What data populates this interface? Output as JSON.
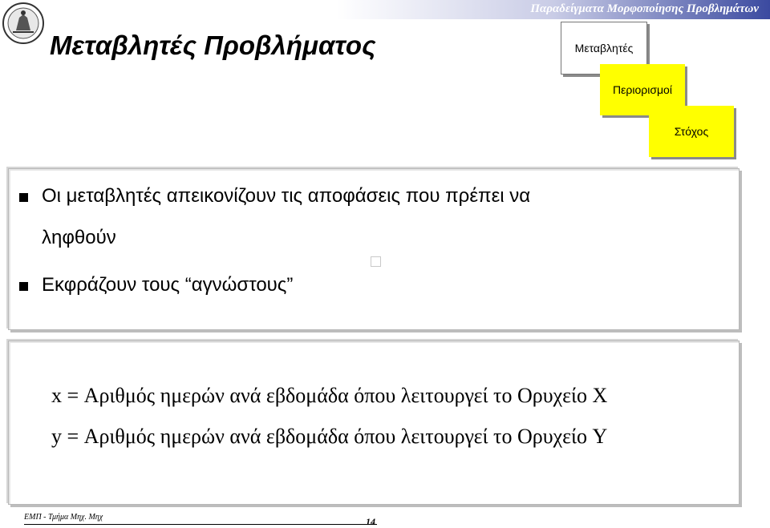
{
  "header": {
    "banner_text": "Παραδείγματα  Μορφοποίησης Προβλημάτων",
    "title": "Μεταβλητές Προβλήματος",
    "logo_icon": "university-seal-icon"
  },
  "tags": {
    "variables": "Μεταβλητές",
    "constraints": "Περιορισμοί",
    "goal": "Στόχος",
    "active_color": "#ffff00"
  },
  "bullets": {
    "item1_line1": "Οι μεταβλητές απεικονίζουν τις αποφάσεις που πρέπει να",
    "item1_line2": "ληφθούν",
    "item2": "Εκφράζουν τους “αγνώστους”"
  },
  "definitions": {
    "x": "x = Αριθμός ημερών ανά εβδομάδα όπου λειτουργεί το Ορυχείο X",
    "y": "y = Αριθμός ημερών ανά εβδομάδα όπου λειτουργεί το Ορυχείο Y"
  },
  "footer": {
    "left": "ΕΜΠ - Τμήμα Μηχ. Μηχ",
    "page_number": "14"
  }
}
